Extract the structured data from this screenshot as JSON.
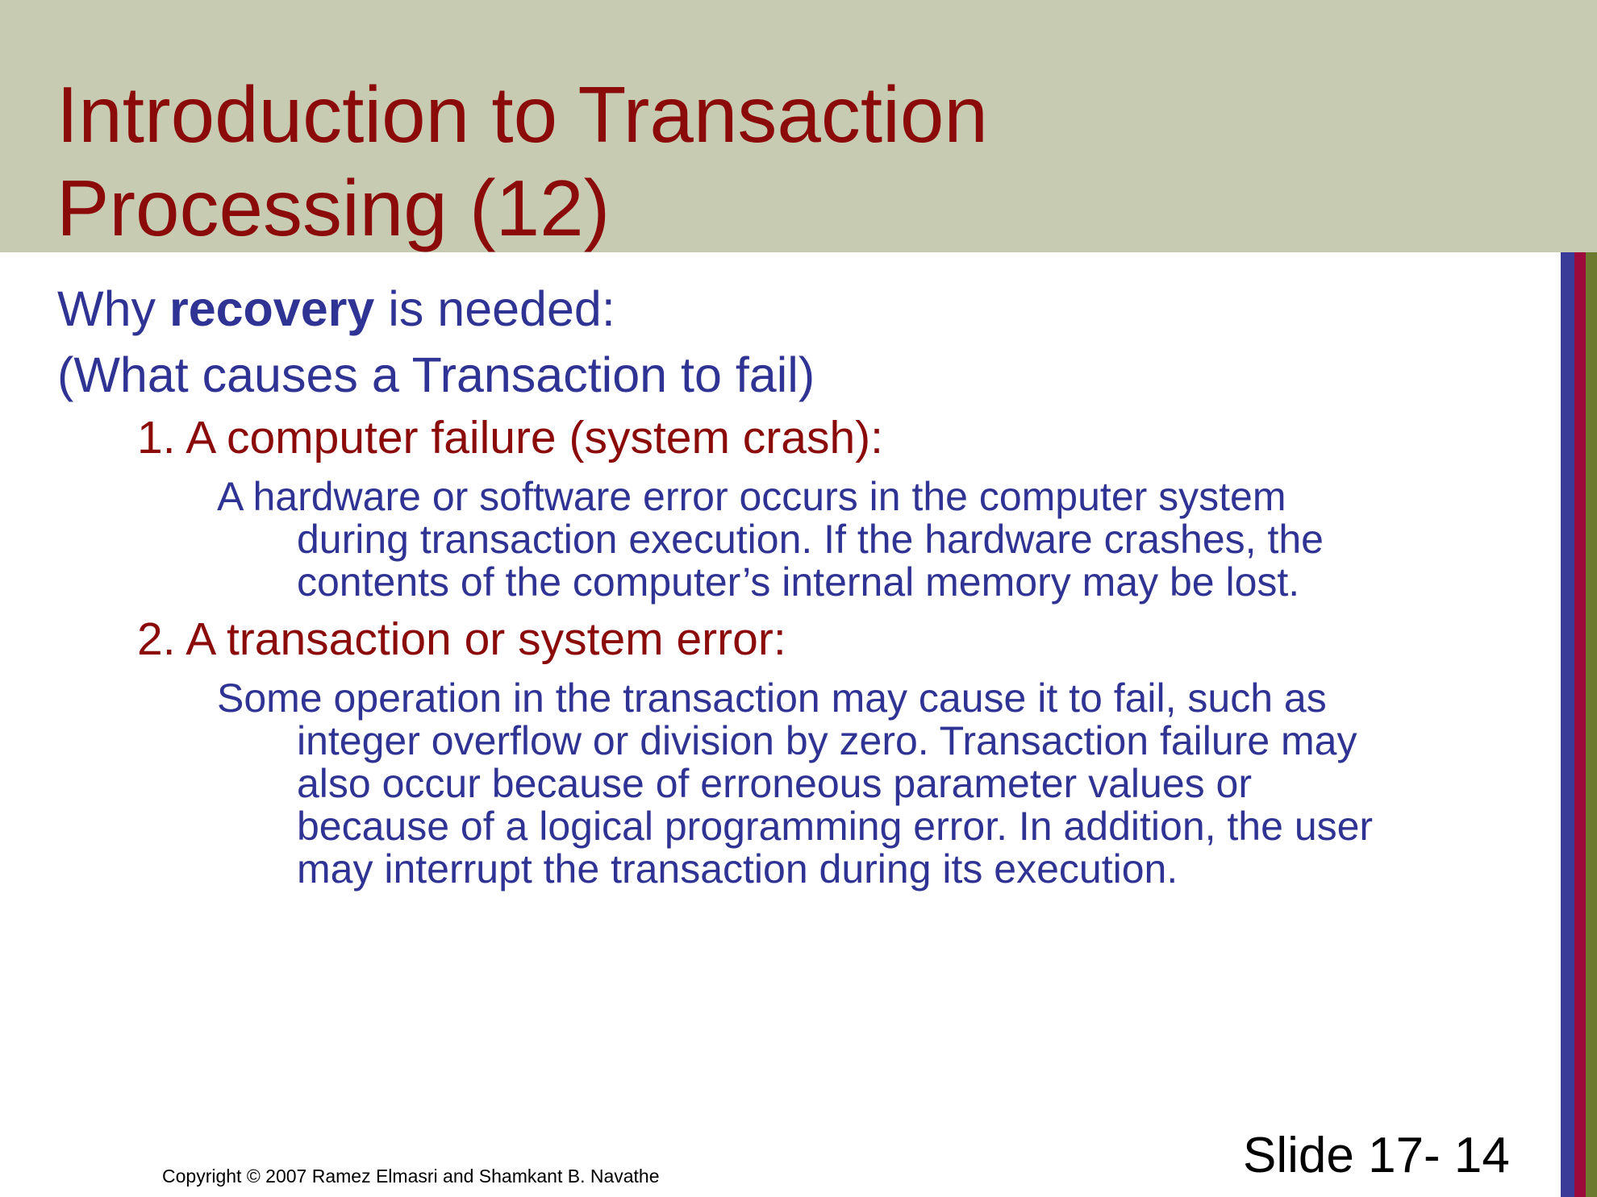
{
  "title": {
    "line1": "Introduction to Transaction",
    "line2": "Processing (12)"
  },
  "body": {
    "intro_prefix": "Why ",
    "intro_bold": "recovery",
    "intro_suffix": " is needed:",
    "intro_sub": "(What causes a Transaction to fail)",
    "items": [
      {
        "heading": "1. A computer failure (system crash):",
        "lines": [
          "A hardware or software error occurs in the computer system",
          "during transaction execution. If the hardware crashes, the",
          "contents of the computer’s internal memory may be lost."
        ]
      },
      {
        "heading": "2. A transaction or system error:",
        "lines": [
          "Some operation in the transaction may cause it to fail, such as",
          "integer overflow or division by zero. Transaction failure may",
          "also occur because of erroneous parameter values or",
          "because of a logical programming error. In addition, the user",
          "may interrupt the transaction during its execution."
        ]
      }
    ]
  },
  "footer": {
    "slide_number": "Slide 17- 14",
    "copyright": "Copyright © 2007 Ramez Elmasri and Shamkant B. Navathe"
  },
  "colors": {
    "title_band": "#c7cbb2",
    "title_text": "#8b0a0a",
    "body_text": "#2f3393",
    "stripe_blue": "#3a3a98",
    "stripe_red": "#9b0a3a",
    "stripe_green": "#6b7a2f"
  }
}
